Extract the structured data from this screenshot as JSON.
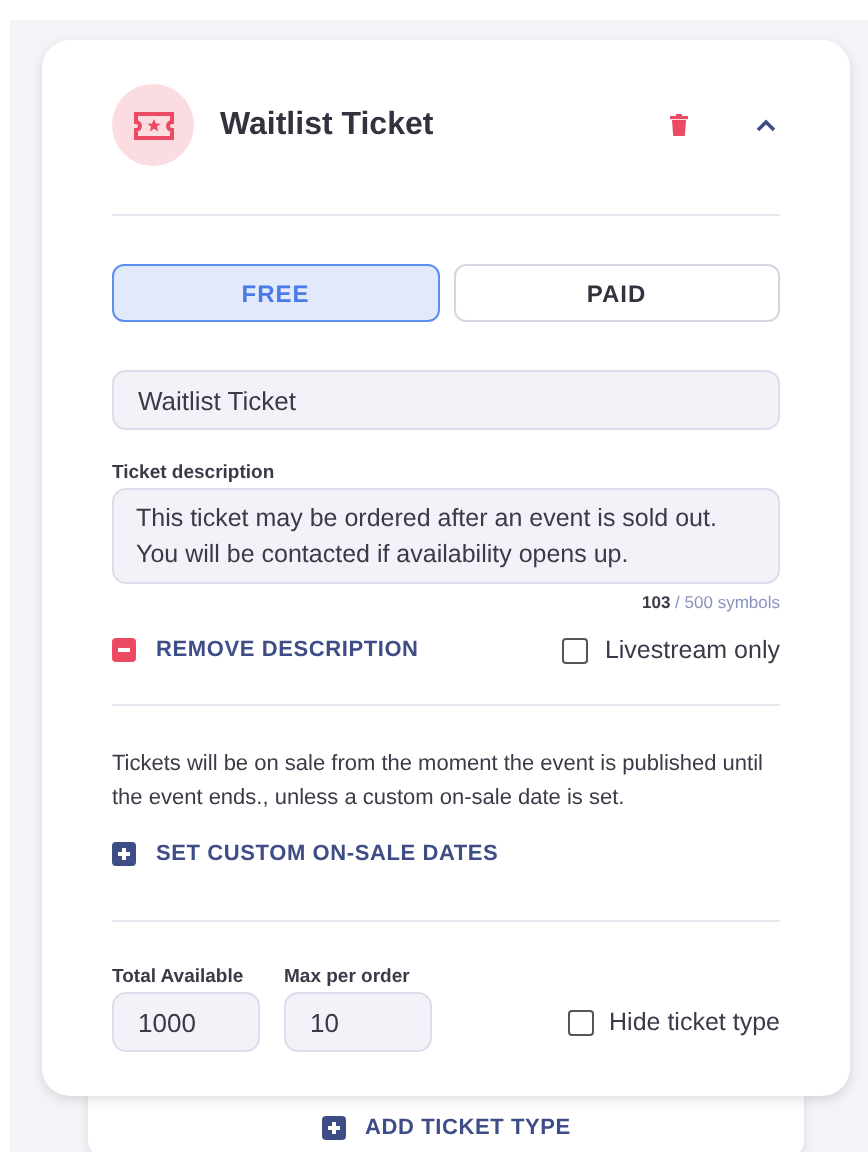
{
  "ticket": {
    "title": "Waitlist Ticket",
    "expanded": true,
    "pricing": [
      {
        "label": "FREE",
        "selected": true
      },
      {
        "label": "PAID",
        "selected": false
      }
    ],
    "name": {
      "value": "Waitlist Ticket"
    },
    "description": {
      "label": "Ticket description",
      "value": "This ticket may be ordered after an event is sold out. You will be contacted if availability opens up.",
      "count": "103",
      "limit": "/ 500 symbols"
    },
    "remove_description": "REMOVE DESCRIPTION",
    "livestream_only": {
      "label": "Livestream only",
      "checked": false
    },
    "sale_note": "Tickets will be on sale from the moment the event is published until the event ends., unless a custom on-sale date is set.",
    "custom_dates": "SET CUSTOM ON-SALE DATES",
    "total_available": {
      "label": "Total Available",
      "value": "1000"
    },
    "max_per_order": {
      "label": "Max per order",
      "value": "10"
    },
    "hide_ticket_type": {
      "label": "Hide ticket type",
      "checked": false
    }
  },
  "add_ticket_type": "ADD TICKET TYPE"
}
